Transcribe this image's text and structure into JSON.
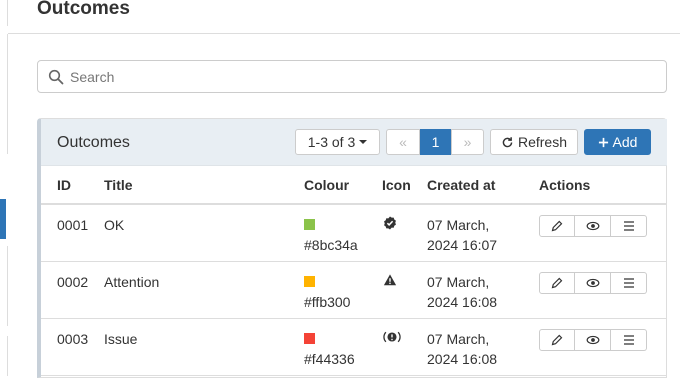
{
  "page": {
    "title": "Outcomes"
  },
  "search": {
    "placeholder": "Search",
    "value": ""
  },
  "panel": {
    "title": "Outcomes",
    "pager_count": "1-3 of 3",
    "prev_label": "«",
    "current_page": "1",
    "next_label": "»",
    "refresh_label": "Refresh",
    "add_label": "Add"
  },
  "table": {
    "headers": {
      "id": "ID",
      "title": "Title",
      "colour": "Colour",
      "icon": "Icon",
      "created": "Created at",
      "actions": "Actions"
    },
    "rows": [
      {
        "id": "0001",
        "title": "OK",
        "colour": "#8bc34a",
        "icon": "check-circle-icon",
        "created_line1": "07 March,",
        "created_line2": "2024 16:07"
      },
      {
        "id": "0002",
        "title": "Attention",
        "colour": "#ffb300",
        "icon": "warning-icon",
        "created_line1": "07 March,",
        "created_line2": "2024 16:08"
      },
      {
        "id": "0003",
        "title": "Issue",
        "colour": "#f44336",
        "icon": "exclamation-circle-icon",
        "created_line1": "07 March,",
        "created_line2": "2024 16:08"
      }
    ]
  },
  "colors": {
    "primary": "#2e75b6",
    "panel_header": "#e8eef3"
  }
}
